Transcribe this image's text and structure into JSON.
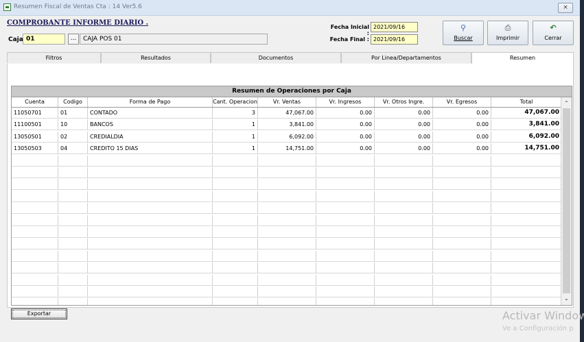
{
  "window": {
    "title": "Resumen Fiscal de Ventas Cta : 14  Ver5.6",
    "close_label": "⨯"
  },
  "header": {
    "title": "COMPROBANTE  INFORME DIARIO .",
    "caja_label": "Caja :",
    "caja_code": "01",
    "caja_lookup_label": "...",
    "caja_name": "CAJA POS 01",
    "fecha_inicial_label": "Fecha Inicial :",
    "fecha_inicial": "2021/09/16",
    "fecha_final_label": "Fecha Final :",
    "fecha_final": "2021/09/16"
  },
  "toolbar": {
    "buscar": {
      "label": "Buscar",
      "icon": "magnifier-icon"
    },
    "imprimir": {
      "label": "Imprimir",
      "icon": "printer-icon"
    },
    "cerrar": {
      "label": "Cerrar",
      "icon": "undo-arrow-icon"
    }
  },
  "tabs": [
    "Filtros",
    "Resultados",
    "Documentos",
    "Por Linea/Departamentos",
    "Resumen"
  ],
  "active_tab": "Resumen",
  "grid": {
    "title": "Resumen de Operaciones por Caja",
    "columns": [
      "Cuenta",
      "Codigo",
      "Forma de Pago",
      "Cant. Operacion",
      "Vr. Ventas",
      "Vr. Ingresos",
      "Vr. Otros Ingre.",
      "Vr. Egresos",
      "Total"
    ],
    "rows": [
      [
        "11050701",
        "01",
        "CONTADO",
        "3",
        "47,067.00",
        "0.00",
        "0.00",
        "0.00",
        "47,067.00"
      ],
      [
        "11100501",
        "10",
        "BANCOS",
        "1",
        "3,841.00",
        "0.00",
        "0.00",
        "0.00",
        "3,841.00"
      ],
      [
        "13050501",
        "02",
        "CREDIALDIA",
        "1",
        "6,092.00",
        "0.00",
        "0.00",
        "0.00",
        "6,092.00"
      ],
      [
        "13050503",
        "04",
        "CREDITO 15 DIAS",
        "1",
        "14,751.00",
        "0.00",
        "0.00",
        "0.00",
        "14,751.00"
      ]
    ],
    "empty_rows": 13
  },
  "footer": {
    "export_label": "Exportar"
  },
  "watermark": {
    "line1": "Activar Window",
    "line2": "Ve a Configuración p"
  }
}
